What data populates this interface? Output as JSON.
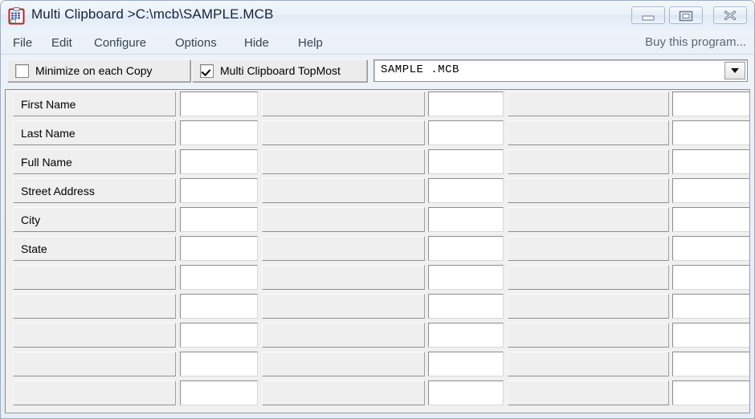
{
  "window": {
    "title": "Multi Clipboard >C:\\mcb\\SAMPLE.MCB",
    "icon": "clipboard-grid-icon",
    "controls": {
      "minimize": "minimize-icon",
      "maximize": "restore-icon",
      "close": "close-icon"
    }
  },
  "menubar": {
    "items": [
      {
        "label": "File"
      },
      {
        "label": "Edit"
      },
      {
        "label": "Configure"
      },
      {
        "label": "Options"
      },
      {
        "label": "Hide"
      },
      {
        "label": "Help"
      }
    ],
    "buy_label": "Buy this program..."
  },
  "toolbar": {
    "minimize_on_copy": {
      "label": "Minimize on each Copy",
      "checked": false
    },
    "topmost": {
      "label": "Multi Clipboard TopMost",
      "checked": true
    },
    "file_combo": {
      "value": "SAMPLE .MCB",
      "arrow_icon": "chevron-down-icon"
    }
  },
  "grid": {
    "rows": [
      {
        "label": "First Name",
        "c1": "",
        "c2": "",
        "c3": "",
        "c4": "",
        "c5": ""
      },
      {
        "label": "Last Name",
        "c1": "",
        "c2": "",
        "c3": "",
        "c4": "",
        "c5": ""
      },
      {
        "label": "Full Name",
        "c1": "",
        "c2": "",
        "c3": "",
        "c4": "",
        "c5": ""
      },
      {
        "label": "Street Address",
        "c1": "",
        "c2": "",
        "c3": "",
        "c4": "",
        "c5": ""
      },
      {
        "label": "City",
        "c1": "",
        "c2": "",
        "c3": "",
        "c4": "",
        "c5": ""
      },
      {
        "label": "State",
        "c1": "",
        "c2": "",
        "c3": "",
        "c4": "",
        "c5": ""
      },
      {
        "label": "",
        "c1": "",
        "c2": "",
        "c3": "",
        "c4": "",
        "c5": ""
      },
      {
        "label": "",
        "c1": "",
        "c2": "",
        "c3": "",
        "c4": "",
        "c5": ""
      },
      {
        "label": "",
        "c1": "",
        "c2": "",
        "c3": "",
        "c4": "",
        "c5": ""
      },
      {
        "label": "",
        "c1": "",
        "c2": "",
        "c3": "",
        "c4": "",
        "c5": ""
      },
      {
        "label": "",
        "c1": "",
        "c2": "",
        "c3": "",
        "c4": "",
        "c5": ""
      }
    ]
  },
  "colors": {
    "titlebar": "#eaf1f8",
    "menubar": "#eef3f9",
    "grid_cell": "#efefef",
    "grid_input": "#ffffff",
    "accent_icon_red": "#b02020",
    "accent_icon_blue": "#2a4fa8"
  }
}
